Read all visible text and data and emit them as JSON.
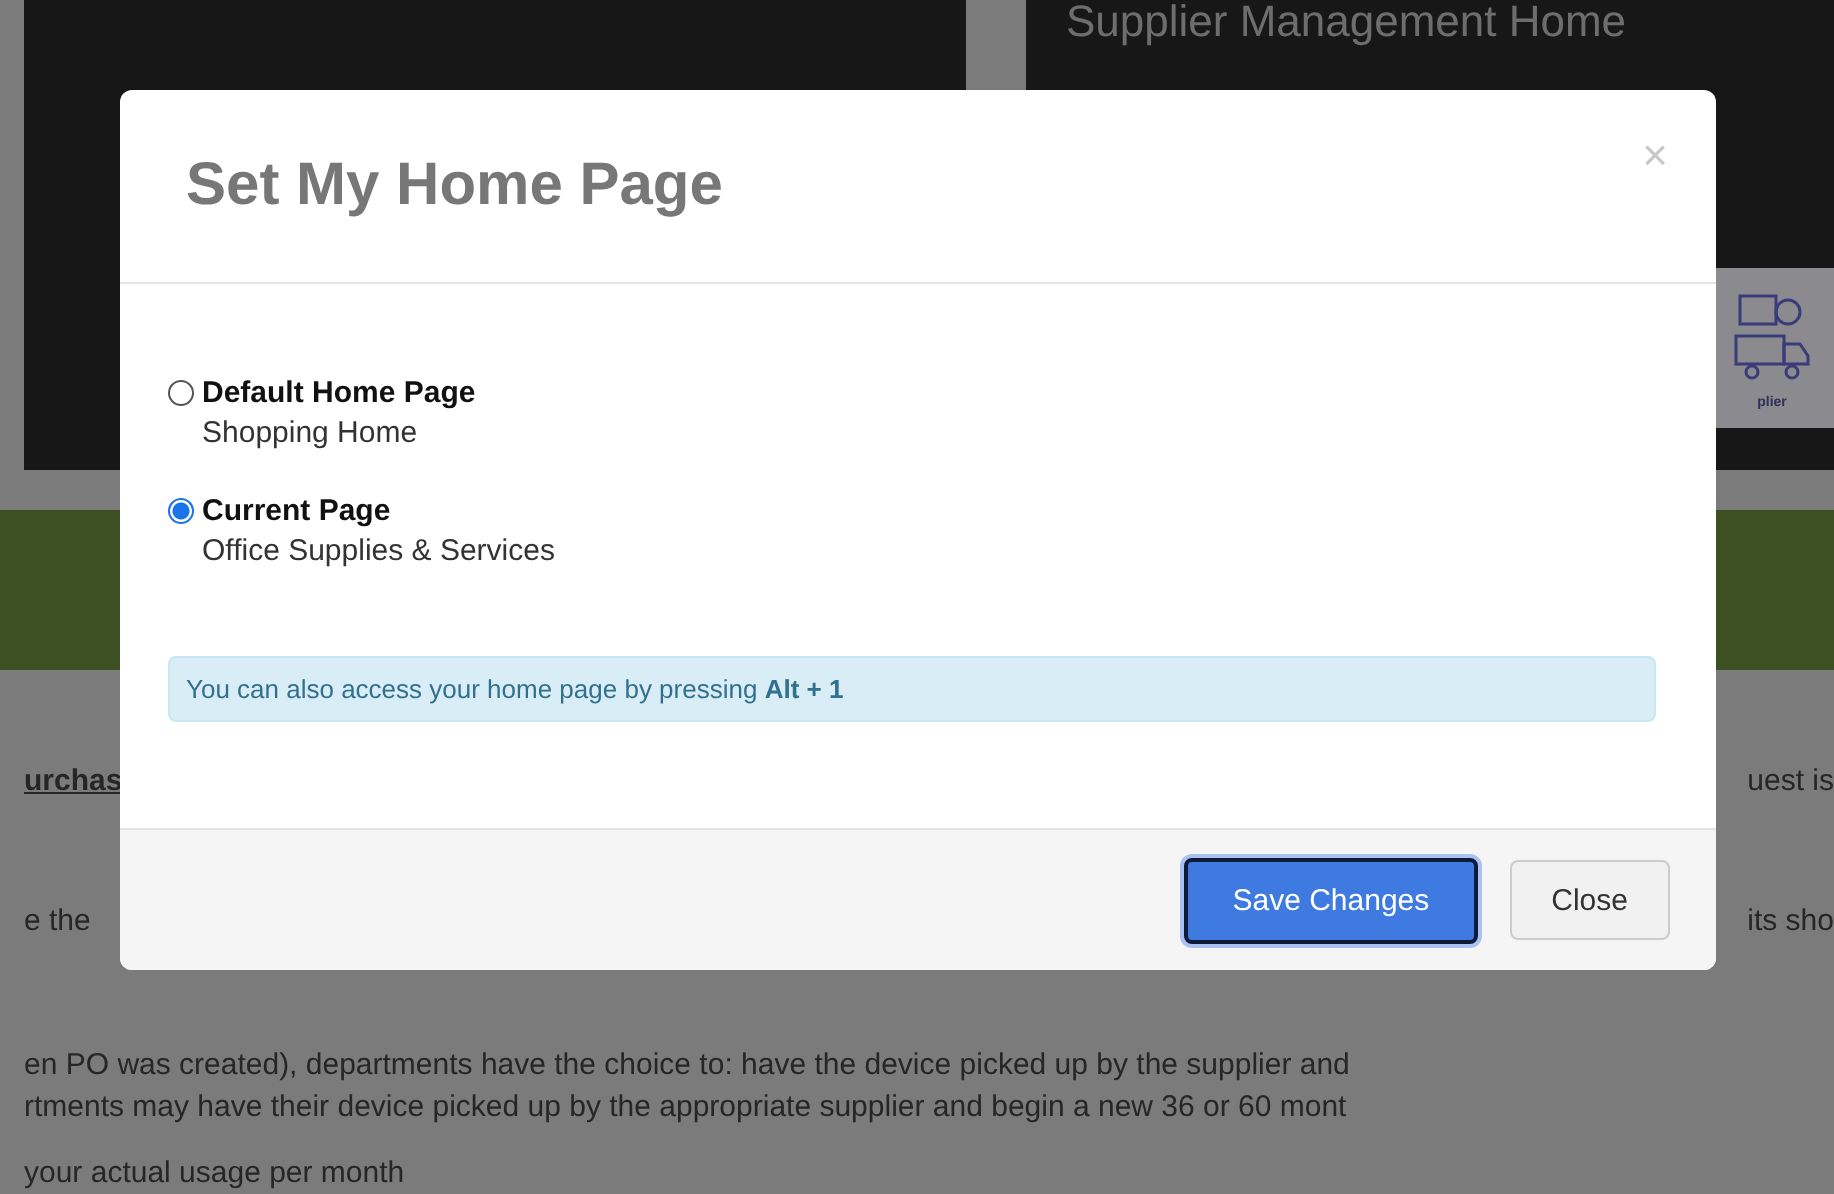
{
  "background": {
    "panel_title": "Supplier Management Home",
    "tile_label": "plier",
    "rows": [
      {
        "left": "urchas",
        "right": "uest is",
        "link": true
      },
      {
        "left": "e the",
        "right": "its sho",
        "link": false
      }
    ],
    "lines": [
      "en PO was created), departments have the choice to: have the device picked up by the supplier and",
      "rtments may have their device picked up by the appropriate supplier and begin a new 36 or 60 mont"
    ],
    "last_line": "your actual usage per month"
  },
  "dialog": {
    "title": "Set My Home Page",
    "close_glyph": "×",
    "options": [
      {
        "label": "Default Home Page",
        "sublabel": "Shopping Home",
        "selected": false
      },
      {
        "label": "Current Page",
        "sublabel": "Office Supplies & Services",
        "selected": true
      }
    ],
    "info": "You can also access your home page by pressing **Alt + 1**",
    "buttons": [
      {
        "label": "Save Changes",
        "kind": "primary"
      },
      {
        "label": "Close",
        "kind": "default"
      }
    ]
  }
}
